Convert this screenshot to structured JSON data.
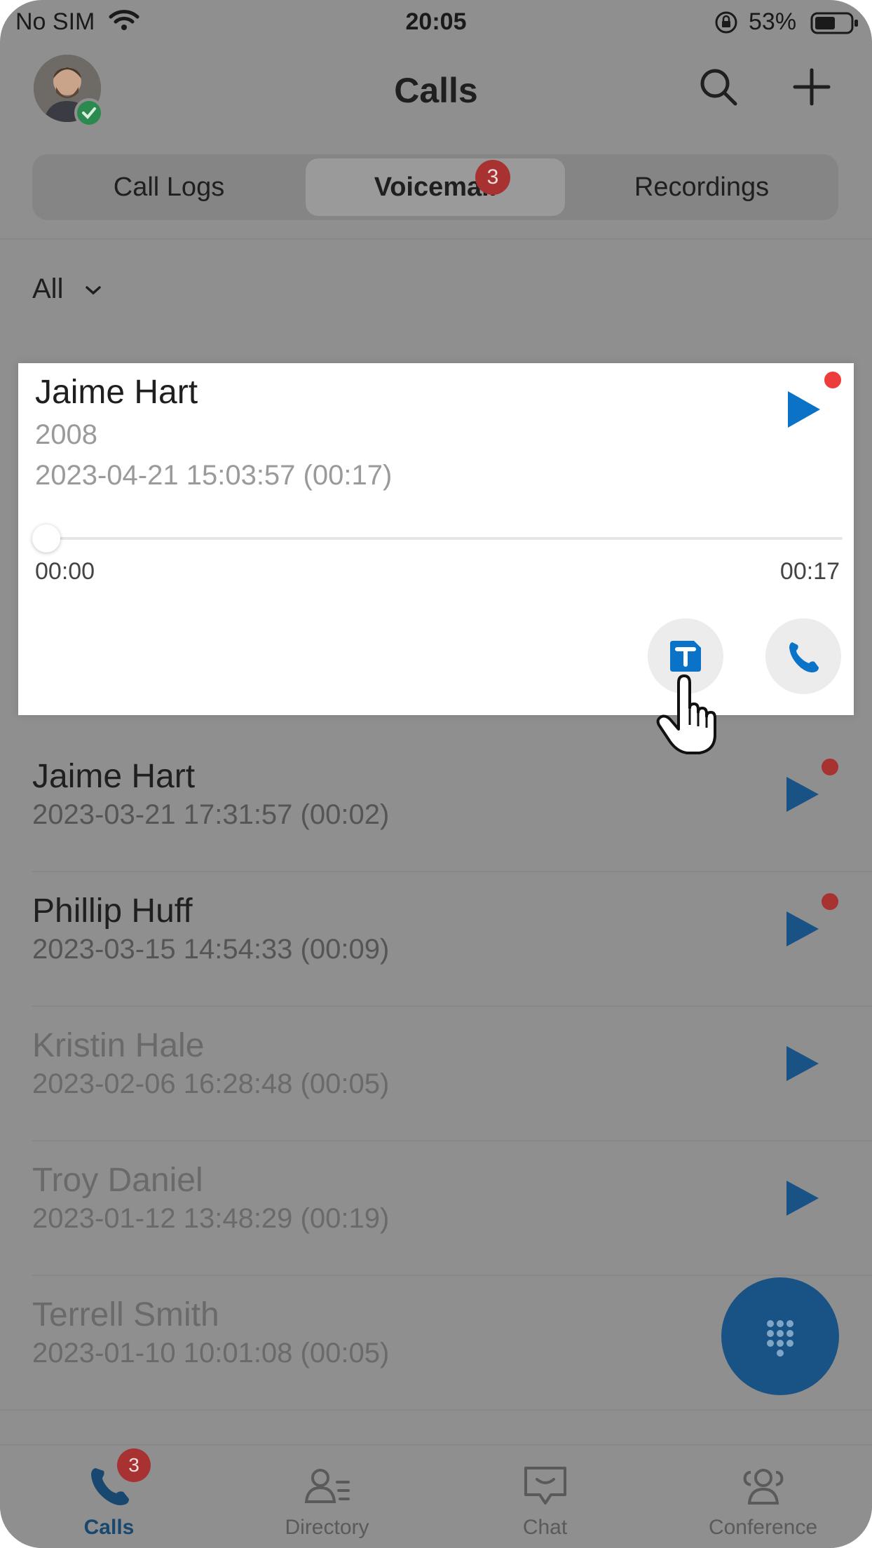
{
  "status_bar": {
    "carrier": "No SIM",
    "time": "20:05",
    "battery": "53%"
  },
  "header": {
    "title": "Calls"
  },
  "tabs": [
    {
      "label": "Call Logs"
    },
    {
      "label": "Voicemail",
      "badge": "3"
    },
    {
      "label": "Recordings"
    }
  ],
  "filter": {
    "label": "All"
  },
  "expanded": {
    "name": "Jaime Hart",
    "extension": "2008",
    "datetime": "2023-04-21 15:03:57 (00:17)",
    "elapsed": "00:00",
    "total": "00:17",
    "progress": 0,
    "unread": true
  },
  "voicemails": [
    {
      "name": "Jaime Hart",
      "datetime": "2023-03-21 17:31:57 (00:02)",
      "unread": true
    },
    {
      "name": "Phillip Huff",
      "datetime": "2023-03-15 14:54:33 (00:09)",
      "unread": true
    },
    {
      "name": "Kristin Hale",
      "datetime": "2023-02-06 16:28:48 (00:05)",
      "unread": false
    },
    {
      "name": "Troy Daniel",
      "datetime": "2023-01-12 13:48:29 (00:19)",
      "unread": false
    },
    {
      "name": "Terrell Smith",
      "datetime": "2023-01-10 10:01:08 (00:05)",
      "unread": false
    }
  ],
  "tabbar": [
    {
      "label": "Calls",
      "badge": "3",
      "icon": "phone-icon",
      "active": true
    },
    {
      "label": "Directory",
      "icon": "directory-icon"
    },
    {
      "label": "Chat",
      "icon": "chat-icon"
    },
    {
      "label": "Conference",
      "icon": "conference-icon"
    }
  ],
  "colors": {
    "accent": "#0a73c8",
    "accent_dimmed": "#195284",
    "unread_dot": "#ee3c3c",
    "overlay_gray": "#8f8f8f"
  }
}
